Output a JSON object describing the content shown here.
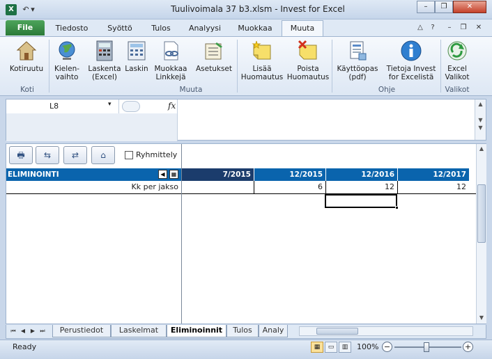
{
  "window": {
    "title": "Tuulivoimala 37 b3.xlsm  -  Invest for Excel",
    "app_icon_text": "X",
    "controls": {
      "minimize": "–",
      "restore": "❐",
      "close": "✕"
    }
  },
  "quick_access": {
    "undo": "↶",
    "customize": "▾"
  },
  "tabs": {
    "file": "File",
    "items": [
      "Tiedosto",
      "Syöttö",
      "Tulos",
      "Analyysi",
      "Muokkaa",
      "Muuta"
    ],
    "active_index": 5,
    "right_controls": [
      "△",
      "?",
      "–",
      "❐",
      "✕"
    ]
  },
  "ribbon": {
    "buttons": [
      {
        "label_1": "Kotiruutu",
        "label_2": "",
        "icon": "house-icon"
      },
      {
        "label_1": "Kielen-",
        "label_2": "vaihto",
        "icon": "globe-icon"
      },
      {
        "label_1": "Laskenta",
        "label_2": "(Excel)",
        "icon": "calculator-icon"
      },
      {
        "label_1": "Laskin",
        "label_2": "",
        "icon": "calculator-small-icon"
      },
      {
        "label_1": "Muokkaa",
        "label_2": "Linkkejä",
        "icon": "link-icon"
      },
      {
        "label_1": "Asetukset",
        "label_2": "",
        "icon": "settings-icon"
      },
      {
        "label_1": "Lisää",
        "label_2": "Huomautus",
        "icon": "add-note-icon"
      },
      {
        "label_1": "Poista",
        "label_2": "Huomautus",
        "icon": "delete-note-icon"
      },
      {
        "label_1": "Käyttöopas",
        "label_2": "(pdf)",
        "icon": "manual-icon"
      },
      {
        "label_1": "Tietoja Invest",
        "label_2": "for Excelistä",
        "icon": "info-icon"
      },
      {
        "label_1": "Excel",
        "label_2": "Valikot",
        "icon": "excel-menu-icon"
      }
    ],
    "groups": [
      "Koti",
      "Muuta",
      "Ohje",
      "Valikot"
    ]
  },
  "formula_bar": {
    "name_box": "L8",
    "name_box_dd": "▾",
    "fx": "fx",
    "formula": ""
  },
  "toolstrip": {
    "buttons": [
      "🖶",
      "⇆",
      "⇄",
      "⌂"
    ],
    "checkbox_label": "Ryhmittely"
  },
  "sheet": {
    "section_label": "ELIMINOINTI",
    "hdr_btn_1": "◀",
    "hdr_btn_2": "▦",
    "columns": [
      "7/2015",
      "12/2015",
      "12/2016",
      "12/2017"
    ],
    "row": {
      "label": "Kk per jakso",
      "values": [
        "",
        "6",
        "12",
        "12"
      ]
    }
  },
  "sheet_tabs": {
    "nav": [
      "⏮",
      "◀",
      "▶",
      "⏭"
    ],
    "items": [
      "Perustiedot",
      "Laskelmat",
      "Eliminoinnit",
      "Tulos",
      "Analy"
    ],
    "active_index": 2
  },
  "status": {
    "text": "Ready",
    "zoom": "100%",
    "zoom_minus": "−",
    "zoom_plus": "+"
  }
}
